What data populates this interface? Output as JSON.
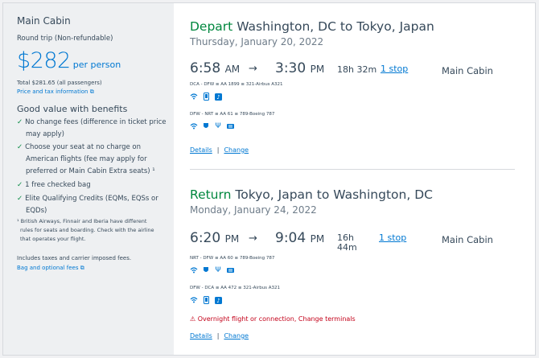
{
  "sidebar": {
    "title": "Main Cabin",
    "subtitle": "Round trip (Non-refundable)",
    "price": "$282",
    "per_person": "per person",
    "total": "Total $281.65 (all passengers)",
    "price_tax_link": "Price and tax information",
    "good_value": "Good value with benefits",
    "benefits": [
      [
        "No change fees (difference in ticket price",
        "may apply)"
      ],
      [
        "Choose your seat at no charge on",
        "American flights (fee may apply for",
        "preferred or Main Cabin Extra seats) ¹"
      ],
      [
        "1 free checked bag"
      ],
      [
        "Elite Qualifying Credits (EQMs, EQSs or",
        "EQDs)"
      ]
    ],
    "footnote": [
      "¹ British Airways, Finnair and Iberia have different",
      "rules for seats and boarding. Check with the airline",
      "that operates your flight."
    ],
    "includes": "Includes taxes and carrier imposed fees.",
    "bag_link": "Bag and optional fees"
  },
  "depart": {
    "label": "Depart",
    "route": "Washington, DC to Tokyo, Japan",
    "date": "Thursday, January 20, 2022",
    "dep_time": "6:58",
    "dep_ampm": "AM",
    "arr_time": "3:30",
    "arr_ampm": "PM",
    "duration": "18h 32m",
    "stops": "1 stop",
    "cabin": "Main Cabin",
    "segments": [
      "DCA - DFW  ≡  AA 1899  ≡  321-Airbus A321",
      "DFW - NRT  ≡  AA 61  ≡  789-Boeing 787"
    ],
    "details": "Details",
    "change": "Change"
  },
  "return": {
    "label": "Return",
    "route": "Tokyo, Japan to Washington, DC",
    "date": "Monday, January 24, 2022",
    "dep_time": "6:20",
    "dep_ampm": "PM",
    "arr_time": "9:04",
    "arr_ampm": "PM",
    "duration": "16h",
    "duration2": "44m",
    "stops": "1 stop",
    "cabin": "Main Cabin",
    "segments": [
      "NRT - DFW  ≡  AA 60  ≡  789-Boeing 787",
      "DFW - DCA  ≡  AA 472  ≡  321-Airbus A321"
    ],
    "warning": "Overnight flight or connection, Change terminals",
    "details": "Details",
    "change": "Change"
  },
  "icons": {
    "wifi": "wifi-icon",
    "power": "power-icon",
    "usb": "usb-icon",
    "entertainment": "entertainment-icon",
    "phone": "device-icon"
  },
  "colors": {
    "accent": "#0078d2",
    "green": "#00873e",
    "warning": "#c30019"
  }
}
